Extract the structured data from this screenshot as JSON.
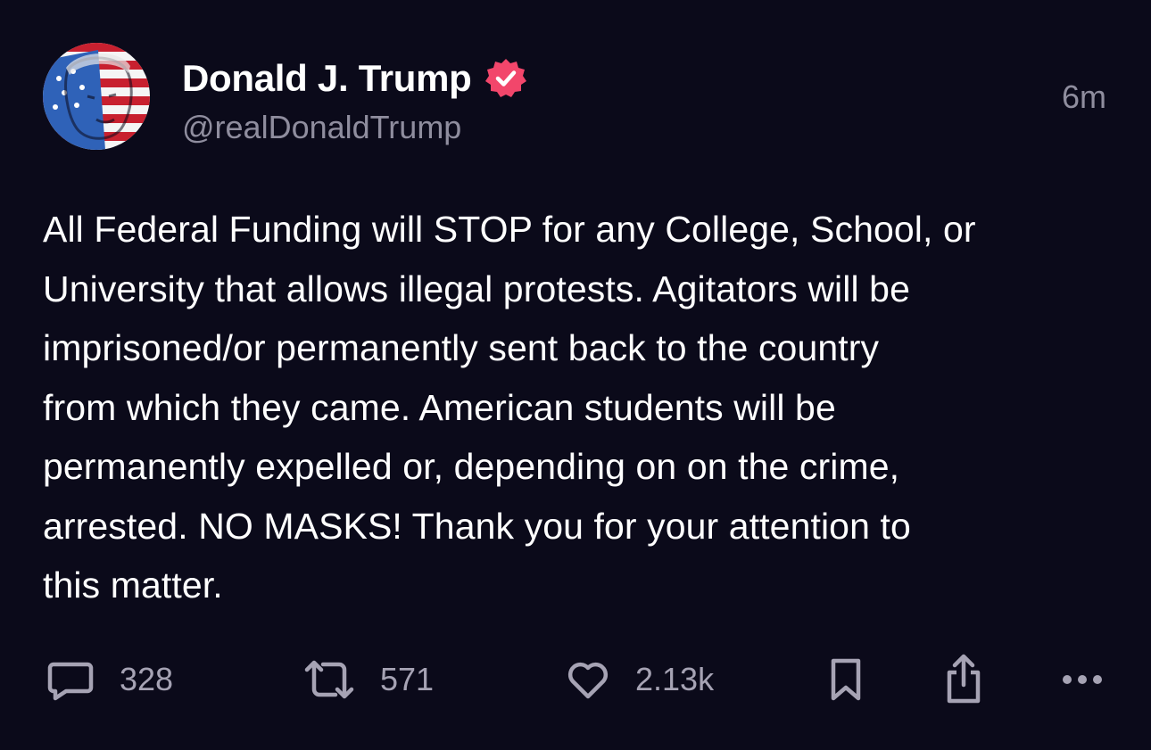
{
  "author": {
    "display_name": "Donald J. Trump",
    "handle": "@realDonaldTrump",
    "verified": true,
    "avatar": "flag-portrait-avatar"
  },
  "timestamp": "6m",
  "body_lines": [
    "All Federal Funding will STOP for any College, School, or",
    "University that allows illegal protests. Agitators will be",
    "imprisoned/or permanently sent back to the country",
    "from which they came. American students will be",
    "permanently expelled or, depending on on the crime,",
    "arrested. NO MASKS! Thank you for your attention to",
    "this matter."
  ],
  "actions": {
    "reply": {
      "icon": "reply-icon",
      "count": "328"
    },
    "repost": {
      "icon": "repost-icon",
      "count": "571"
    },
    "like": {
      "icon": "heart-icon",
      "count": "2.13k"
    },
    "bookmark": {
      "icon": "bookmark-icon"
    },
    "share": {
      "icon": "share-icon"
    },
    "more": {
      "icon": "more-icon"
    }
  },
  "colors": {
    "background": "#0b0a1a",
    "primary_text": "#ffffff",
    "secondary_text": "#8f8d9e",
    "icon": "#a6a3b4",
    "verified_badge": "#f2466b"
  }
}
